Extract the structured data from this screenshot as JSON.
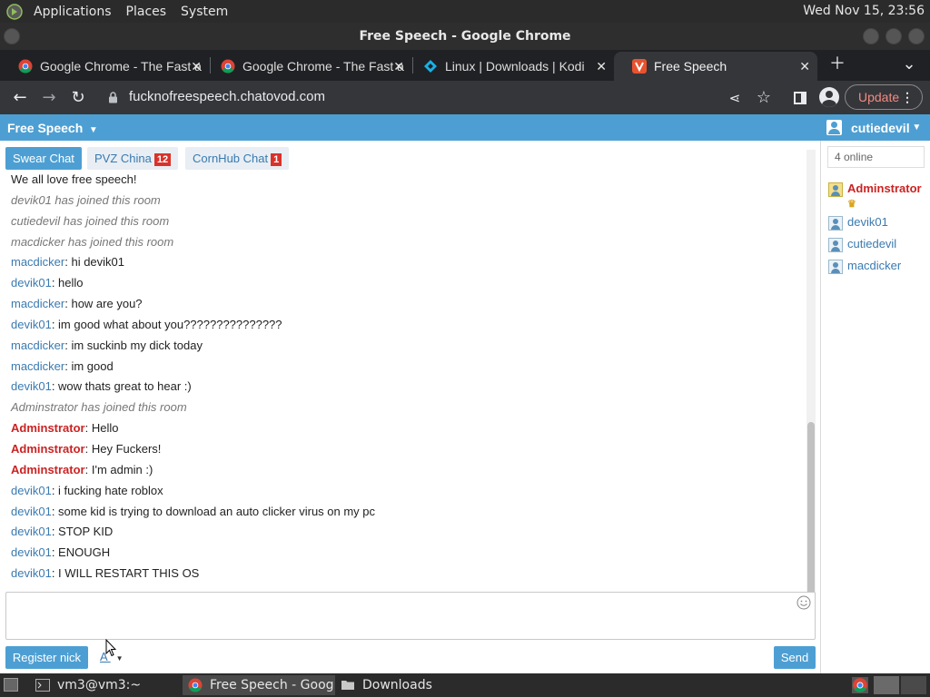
{
  "system_bar": {
    "menus": [
      "Applications",
      "Places",
      "System"
    ],
    "clock": "Wed Nov 15, 23:56"
  },
  "window": {
    "title": "Free Speech - Google Chrome"
  },
  "browser": {
    "tabs": [
      {
        "label": "Google Chrome - The Fast a",
        "icon": "chrome-icon"
      },
      {
        "label": "Google Chrome - The Fast a",
        "icon": "chrome-icon"
      },
      {
        "label": "Linux | Downloads | Kodi",
        "icon": "kodi-icon"
      },
      {
        "label": "Free Speech",
        "icon": "chatovod-icon",
        "active": true
      }
    ],
    "url": "fucknofreespeech.chatovod.com",
    "update_label": "Update"
  },
  "chat": {
    "room_title": "Free Speech",
    "current_user": "cutiedevil",
    "rooms": [
      {
        "label": "Swear Chat",
        "badge": ""
      },
      {
        "label": "PVZ China",
        "badge": "12"
      },
      {
        "label": "CornHub Chat",
        "badge": "1"
      }
    ],
    "messages": [
      {
        "type": "text",
        "nick": "",
        "text": "We all love free speech!"
      },
      {
        "type": "sys",
        "text": "devik01 has joined this room"
      },
      {
        "type": "sys",
        "text": "cutiedevil has joined this room"
      },
      {
        "type": "sys",
        "text": "macdicker has joined this room"
      },
      {
        "type": "msg",
        "nick": "macdicker",
        "text": ": hi devik01"
      },
      {
        "type": "msg",
        "nick": "devik01",
        "text": ": hello"
      },
      {
        "type": "msg",
        "nick": "macdicker",
        "text": ": how are you?"
      },
      {
        "type": "msg",
        "nick": "devik01",
        "text": ": im good what about you???????????????"
      },
      {
        "type": "msg",
        "nick": "macdicker",
        "text": ": im suckinb my dick today"
      },
      {
        "type": "msg",
        "nick": "macdicker",
        "text": ": im good"
      },
      {
        "type": "msg",
        "nick": "devik01",
        "text": ": wow thats great to hear :)"
      },
      {
        "type": "sys",
        "text": "Adminstrator has joined this room"
      },
      {
        "type": "admin",
        "nick": "Adminstrator",
        "text": ": Hello"
      },
      {
        "type": "admin",
        "nick": "Adminstrator",
        "text": ": Hey Fuckers!"
      },
      {
        "type": "admin",
        "nick": "Adminstrator",
        "text": ": I'm admin :)"
      },
      {
        "type": "msg",
        "nick": "devik01",
        "text": ": i fucking hate roblox"
      },
      {
        "type": "msg",
        "nick": "devik01",
        "text": ": some kid is trying to download an auto clicker virus on my pc"
      },
      {
        "type": "msg",
        "nick": "devik01",
        "text": ": STOP KID"
      },
      {
        "type": "msg",
        "nick": "devik01",
        "text": ": ENOUGH"
      },
      {
        "type": "msg",
        "nick": "devik01",
        "text": ": I WILL RESTART THIS OS"
      }
    ],
    "input_value": "",
    "register_label": "Register nick",
    "font_label": "A",
    "send_label": "Send",
    "online_label": "4 online",
    "users": [
      {
        "name": "Adminstrator",
        "admin": true
      },
      {
        "name": "devik01",
        "admin": false
      },
      {
        "name": "cutiedevil",
        "admin": false
      },
      {
        "name": "macdicker",
        "admin": false
      }
    ]
  },
  "taskbar": {
    "items": [
      {
        "label": "vm3@vm3:~",
        "icon": "terminal-icon"
      },
      {
        "label": "Free Speech - Goog...",
        "icon": "chrome-icon",
        "active": true
      },
      {
        "label": "Downloads",
        "icon": "folder-icon"
      }
    ]
  }
}
